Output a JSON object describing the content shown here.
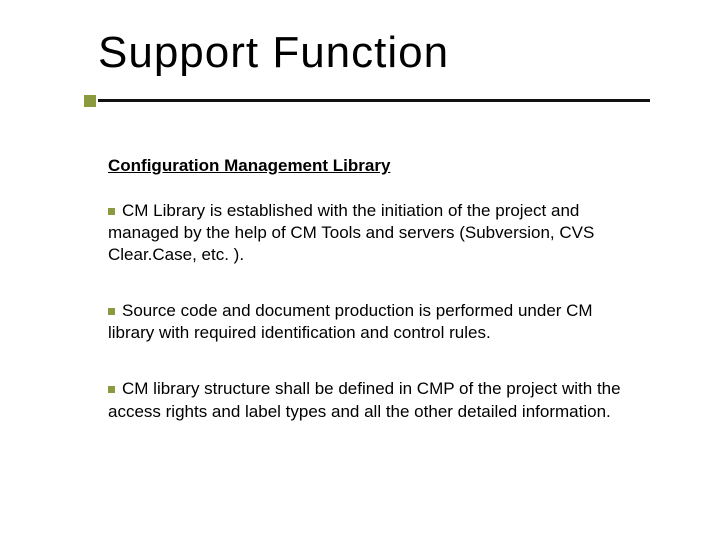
{
  "title": "Support Function",
  "subtitle": "Configuration Management Library",
  "bullets": [
    "CM Library is established with the initiation of the project and managed by the help of CM Tools and servers (Subversion, CVS Clear.Case, etc. ).",
    "Source code and document production is performed under CM library with required identification and control rules.",
    "CM library structure shall be defined in CMP of the project with the access rights and label types and all the other detailed information."
  ]
}
